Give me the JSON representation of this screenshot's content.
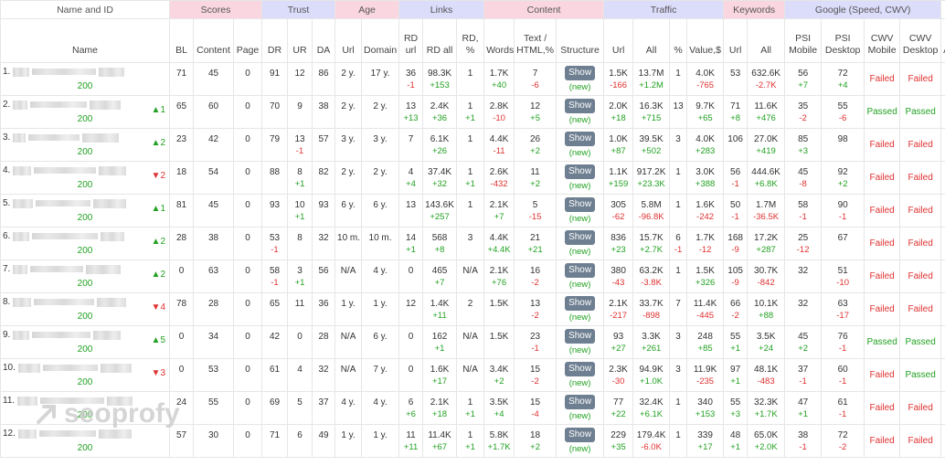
{
  "groups": {
    "name_id": "Name and ID",
    "scores": "Scores",
    "trust": "Trust",
    "age": "Age",
    "links": "Links",
    "content": "Content",
    "traffic": "Traffic",
    "keywords": "Keywords",
    "google": "Google (Speed, CWV)"
  },
  "columns": {
    "name": "Name",
    "bl": "BL",
    "content": "Content",
    "page": "Page",
    "dr": "DR",
    "ur": "UR",
    "da": "DA",
    "age_url": "Url",
    "age_domain": "Domain",
    "rd_url": "RD url",
    "rd_all": "RD all",
    "rd_pct": "RD, %",
    "words": "Words",
    "text_html": "Text / HTML,%",
    "structure": "Structure",
    "traffic_url": "Url",
    "traffic_all": "All",
    "traffic_pct": "%",
    "traffic_value": "Value,$",
    "kw_url": "Url",
    "kw_all": "All",
    "psi_mobile": "PSI Mobile",
    "psi_desktop": "PSI Desktop",
    "cwv_mobile": "CWV Mobile",
    "cwv_desktop": "CWV Desktop",
    "extra": "A"
  },
  "show_label": "Show",
  "new_label": "(new)",
  "watermark_text": "seoprofy",
  "colors": {
    "positive": "#22a122",
    "negative": "#e03030",
    "pink_header": "#f9d6e0",
    "blue_header": "#dcdcfb",
    "button": "#6e7f91"
  },
  "rows": [
    {
      "idx": "1.",
      "status": "200",
      "rank_dir": "",
      "rank": "",
      "bl": "71",
      "content": "45",
      "page": "0",
      "dr": "91",
      "dr_d": "",
      "ur": "12",
      "ur_d": "",
      "da": "86",
      "age_url": "2 y.",
      "age_domain": "17 y.",
      "rd_url": "36",
      "rd_url_d": "-1",
      "rd_all": "98.3K",
      "rd_all_d": "+153",
      "rd_pct": "1",
      "rd_pct_d": "",
      "words": "1.7K",
      "words_d": "+40",
      "text": "7",
      "text_d": "-6",
      "t_url": "1.5K",
      "t_url_d": "-166",
      "t_all": "13.7M",
      "t_all_d": "+1.2M",
      "t_pct": "1",
      "t_pct_d": "",
      "t_val": "4.0K",
      "t_val_d": "-765",
      "kw_url": "53",
      "kw_url_d": "",
      "kw_all": "632.6K",
      "kw_all_d": "-2.7K",
      "psi_m": "56",
      "psi_m_d": "+7",
      "psi_d": "72",
      "psi_d_d": "+4",
      "cwv_m": "Failed",
      "cwv_d": "Failed"
    },
    {
      "idx": "2.",
      "status": "200",
      "rank_dir": "up",
      "rank": "1",
      "bl": "65",
      "content": "60",
      "page": "0",
      "dr": "70",
      "dr_d": "",
      "ur": "9",
      "ur_d": "",
      "da": "38",
      "age_url": "2 y.",
      "age_domain": "2 y.",
      "rd_url": "13",
      "rd_url_d": "+13",
      "rd_all": "2.4K",
      "rd_all_d": "+36",
      "rd_pct": "1",
      "rd_pct_d": "+1",
      "words": "2.8K",
      "words_d": "-10",
      "text": "12",
      "text_d": "+5",
      "t_url": "2.0K",
      "t_url_d": "+18",
      "t_all": "16.3K",
      "t_all_d": "+715",
      "t_pct": "13",
      "t_pct_d": "",
      "t_val": "9.7K",
      "t_val_d": "+65",
      "kw_url": "71",
      "kw_url_d": "+8",
      "kw_all": "11.6K",
      "kw_all_d": "+476",
      "psi_m": "35",
      "psi_m_d": "-2",
      "psi_d": "55",
      "psi_d_d": "-6",
      "cwv_m": "Passed",
      "cwv_d": "Passed"
    },
    {
      "idx": "3.",
      "status": "200",
      "rank_dir": "up",
      "rank": "2",
      "bl": "23",
      "content": "42",
      "page": "0",
      "dr": "79",
      "dr_d": "",
      "ur": "13",
      "ur_d": "-1",
      "da": "57",
      "age_url": "3 y.",
      "age_domain": "3 y.",
      "rd_url": "7",
      "rd_url_d": "",
      "rd_all": "6.1K",
      "rd_all_d": "+26",
      "rd_pct": "1",
      "rd_pct_d": "",
      "words": "4.4K",
      "words_d": "-11",
      "text": "26",
      "text_d": "+2",
      "t_url": "1.0K",
      "t_url_d": "+87",
      "t_all": "39.5K",
      "t_all_d": "+502",
      "t_pct": "3",
      "t_pct_d": "",
      "t_val": "4.0K",
      "t_val_d": "+283",
      "kw_url": "106",
      "kw_url_d": "",
      "kw_all": "27.0K",
      "kw_all_d": "+419",
      "psi_m": "85",
      "psi_m_d": "+3",
      "psi_d": "98",
      "psi_d_d": "",
      "cwv_m": "Failed",
      "cwv_d": "Failed"
    },
    {
      "idx": "4.",
      "status": "200",
      "rank_dir": "down",
      "rank": "2",
      "bl": "18",
      "content": "54",
      "page": "0",
      "dr": "88",
      "dr_d": "",
      "ur": "8",
      "ur_d": "+1",
      "da": "82",
      "age_url": "2 y.",
      "age_domain": "2 y.",
      "rd_url": "4",
      "rd_url_d": "+4",
      "rd_all": "37.4K",
      "rd_all_d": "+32",
      "rd_pct": "1",
      "rd_pct_d": "+1",
      "words": "2.6K",
      "words_d": "-432",
      "text": "11",
      "text_d": "+2",
      "t_url": "1.1K",
      "t_url_d": "+159",
      "t_all": "917.2K",
      "t_all_d": "+23.3K",
      "t_pct": "1",
      "t_pct_d": "",
      "t_val": "3.0K",
      "t_val_d": "+388",
      "kw_url": "56",
      "kw_url_d": "-1",
      "kw_all": "444.6K",
      "kw_all_d": "+6.8K",
      "psi_m": "45",
      "psi_m_d": "-8",
      "psi_d": "92",
      "psi_d_d": "+2",
      "cwv_m": "Failed",
      "cwv_d": "Failed"
    },
    {
      "idx": "5.",
      "status": "200",
      "rank_dir": "up",
      "rank": "1",
      "bl": "81",
      "content": "45",
      "page": "0",
      "dr": "93",
      "dr_d": "",
      "ur": "10",
      "ur_d": "+1",
      "da": "93",
      "age_url": "6 y.",
      "age_domain": "6 y.",
      "rd_url": "13",
      "rd_url_d": "",
      "rd_all": "143.6K",
      "rd_all_d": "+257",
      "rd_pct": "1",
      "rd_pct_d": "",
      "words": "2.1K",
      "words_d": "+7",
      "text": "5",
      "text_d": "-15",
      "t_url": "305",
      "t_url_d": "-62",
      "t_all": "5.8M",
      "t_all_d": "-96.8K",
      "t_pct": "1",
      "t_pct_d": "",
      "t_val": "1.6K",
      "t_val_d": "-242",
      "kw_url": "50",
      "kw_url_d": "-1",
      "kw_all": "1.7M",
      "kw_all_d": "-36.5K",
      "psi_m": "58",
      "psi_m_d": "-1",
      "psi_d": "90",
      "psi_d_d": "-1",
      "cwv_m": "Failed",
      "cwv_d": "Failed"
    },
    {
      "idx": "6.",
      "status": "200",
      "rank_dir": "up",
      "rank": "2",
      "bl": "28",
      "content": "38",
      "page": "0",
      "dr": "53",
      "dr_d": "-1",
      "ur": "8",
      "ur_d": "",
      "da": "32",
      "age_url": "10 m.",
      "age_domain": "10 m.",
      "rd_url": "14",
      "rd_url_d": "+1",
      "rd_all": "568",
      "rd_all_d": "+8",
      "rd_pct": "3",
      "rd_pct_d": "",
      "words": "4.4K",
      "words_d": "+4.4K",
      "text": "21",
      "text_d": "+21",
      "t_url": "836",
      "t_url_d": "+23",
      "t_all": "15.7K",
      "t_all_d": "+2.7K",
      "t_pct": "6",
      "t_pct_d": "-1",
      "t_val": "1.7K",
      "t_val_d": "-12",
      "kw_url": "168",
      "kw_url_d": "-9",
      "kw_all": "17.2K",
      "kw_all_d": "+287",
      "psi_m": "25",
      "psi_m_d": "-12",
      "psi_d": "67",
      "psi_d_d": "",
      "cwv_m": "Failed",
      "cwv_d": "Failed"
    },
    {
      "idx": "7.",
      "status": "200",
      "rank_dir": "up",
      "rank": "2",
      "bl": "0",
      "content": "63",
      "page": "0",
      "dr": "58",
      "dr_d": "-1",
      "ur": "3",
      "ur_d": "+1",
      "da": "56",
      "age_url": "N/A",
      "age_domain": "4 y.",
      "rd_url": "0",
      "rd_url_d": "",
      "rd_all": "465",
      "rd_all_d": "+7",
      "rd_pct": "N/A",
      "rd_pct_d": "",
      "words": "2.1K",
      "words_d": "+76",
      "text": "16",
      "text_d": "-2",
      "t_url": "380",
      "t_url_d": "-43",
      "t_all": "63.2K",
      "t_all_d": "-3.8K",
      "t_pct": "1",
      "t_pct_d": "",
      "t_val": "1.5K",
      "t_val_d": "+326",
      "kw_url": "105",
      "kw_url_d": "-9",
      "kw_all": "30.7K",
      "kw_all_d": "-842",
      "psi_m": "32",
      "psi_m_d": "",
      "psi_d": "51",
      "psi_d_d": "-10",
      "cwv_m": "Failed",
      "cwv_d": "Failed"
    },
    {
      "idx": "8.",
      "status": "200",
      "rank_dir": "down",
      "rank": "4",
      "bl": "78",
      "content": "28",
      "page": "0",
      "dr": "65",
      "dr_d": "",
      "ur": "11",
      "ur_d": "",
      "da": "36",
      "age_url": "1 y.",
      "age_domain": "1 y.",
      "rd_url": "12",
      "rd_url_d": "",
      "rd_all": "1.4K",
      "rd_all_d": "+11",
      "rd_pct": "2",
      "rd_pct_d": "",
      "words": "1.5K",
      "words_d": "",
      "text": "13",
      "text_d": "-2",
      "t_url": "2.1K",
      "t_url_d": "-217",
      "t_all": "33.7K",
      "t_all_d": "-898",
      "t_pct": "7",
      "t_pct_d": "",
      "t_val": "11.4K",
      "t_val_d": "-445",
      "kw_url": "66",
      "kw_url_d": "-2",
      "kw_all": "10.1K",
      "kw_all_d": "+88",
      "psi_m": "32",
      "psi_m_d": "",
      "psi_d": "63",
      "psi_d_d": "-17",
      "cwv_m": "Failed",
      "cwv_d": "Failed"
    },
    {
      "idx": "9.",
      "status": "200",
      "rank_dir": "up",
      "rank": "5",
      "bl": "0",
      "content": "34",
      "page": "0",
      "dr": "42",
      "dr_d": "",
      "ur": "0",
      "ur_d": "",
      "da": "28",
      "age_url": "N/A",
      "age_domain": "6 y.",
      "rd_url": "0",
      "rd_url_d": "",
      "rd_all": "162",
      "rd_all_d": "+1",
      "rd_pct": "N/A",
      "rd_pct_d": "",
      "words": "1.5K",
      "words_d": "",
      "text": "23",
      "text_d": "-1",
      "t_url": "93",
      "t_url_d": "+27",
      "t_all": "3.3K",
      "t_all_d": "+261",
      "t_pct": "3",
      "t_pct_d": "",
      "t_val": "248",
      "t_val_d": "+85",
      "kw_url": "55",
      "kw_url_d": "+1",
      "kw_all": "3.5K",
      "kw_all_d": "+24",
      "psi_m": "45",
      "psi_m_d": "+2",
      "psi_d": "76",
      "psi_d_d": "-1",
      "cwv_m": "Passed",
      "cwv_d": "Passed"
    },
    {
      "idx": "10.",
      "status": "200",
      "rank_dir": "down",
      "rank": "3",
      "bl": "0",
      "content": "53",
      "page": "0",
      "dr": "61",
      "dr_d": "",
      "ur": "4",
      "ur_d": "",
      "da": "32",
      "age_url": "N/A",
      "age_domain": "7 y.",
      "rd_url": "0",
      "rd_url_d": "",
      "rd_all": "1.6K",
      "rd_all_d": "+17",
      "rd_pct": "N/A",
      "rd_pct_d": "",
      "words": "3.4K",
      "words_d": "+2",
      "text": "15",
      "text_d": "-2",
      "t_url": "2.3K",
      "t_url_d": "-30",
      "t_all": "94.9K",
      "t_all_d": "+1.0K",
      "t_pct": "3",
      "t_pct_d": "",
      "t_val": "11.9K",
      "t_val_d": "-235",
      "kw_url": "97",
      "kw_url_d": "+1",
      "kw_all": "48.1K",
      "kw_all_d": "-483",
      "psi_m": "37",
      "psi_m_d": "-1",
      "psi_d": "60",
      "psi_d_d": "-1",
      "cwv_m": "Failed",
      "cwv_d": "Passed"
    },
    {
      "idx": "11.",
      "status": "200",
      "rank_dir": "",
      "rank": "",
      "bl": "24",
      "content": "55",
      "page": "0",
      "dr": "69",
      "dr_d": "",
      "ur": "5",
      "ur_d": "",
      "da": "37",
      "age_url": "4 y.",
      "age_domain": "4 y.",
      "rd_url": "6",
      "rd_url_d": "+6",
      "rd_all": "2.1K",
      "rd_all_d": "+18",
      "rd_pct": "1",
      "rd_pct_d": "+1",
      "words": "3.5K",
      "words_d": "+4",
      "text": "15",
      "text_d": "-4",
      "t_url": "77",
      "t_url_d": "+22",
      "t_all": "32.4K",
      "t_all_d": "+6.1K",
      "t_pct": "1",
      "t_pct_d": "",
      "t_val": "340",
      "t_val_d": "+153",
      "kw_url": "55",
      "kw_url_d": "+3",
      "kw_all": "32.3K",
      "kw_all_d": "+1.7K",
      "psi_m": "47",
      "psi_m_d": "+1",
      "psi_d": "61",
      "psi_d_d": "-1",
      "cwv_m": "Failed",
      "cwv_d": "Failed"
    },
    {
      "idx": "12.",
      "status": "200",
      "rank_dir": "",
      "rank": "",
      "bl": "57",
      "content": "30",
      "page": "0",
      "dr": "71",
      "dr_d": "",
      "ur": "6",
      "ur_d": "",
      "da": "49",
      "age_url": "1 y.",
      "age_domain": "1 y.",
      "rd_url": "11",
      "rd_url_d": "+11",
      "rd_all": "11.4K",
      "rd_all_d": "+67",
      "rd_pct": "1",
      "rd_pct_d": "+1",
      "words": "5.8K",
      "words_d": "+1.7K",
      "text": "18",
      "text_d": "+2",
      "t_url": "229",
      "t_url_d": "+35",
      "t_all": "179.4K",
      "t_all_d": "-6.0K",
      "t_pct": "1",
      "t_pct_d": "",
      "t_val": "339",
      "t_val_d": "+17",
      "kw_url": "48",
      "kw_url_d": "+1",
      "kw_all": "65.0K",
      "kw_all_d": "+2.0K",
      "psi_m": "38",
      "psi_m_d": "-1",
      "psi_d": "72",
      "psi_d_d": "-2",
      "cwv_m": "Failed",
      "cwv_d": "Failed"
    }
  ]
}
